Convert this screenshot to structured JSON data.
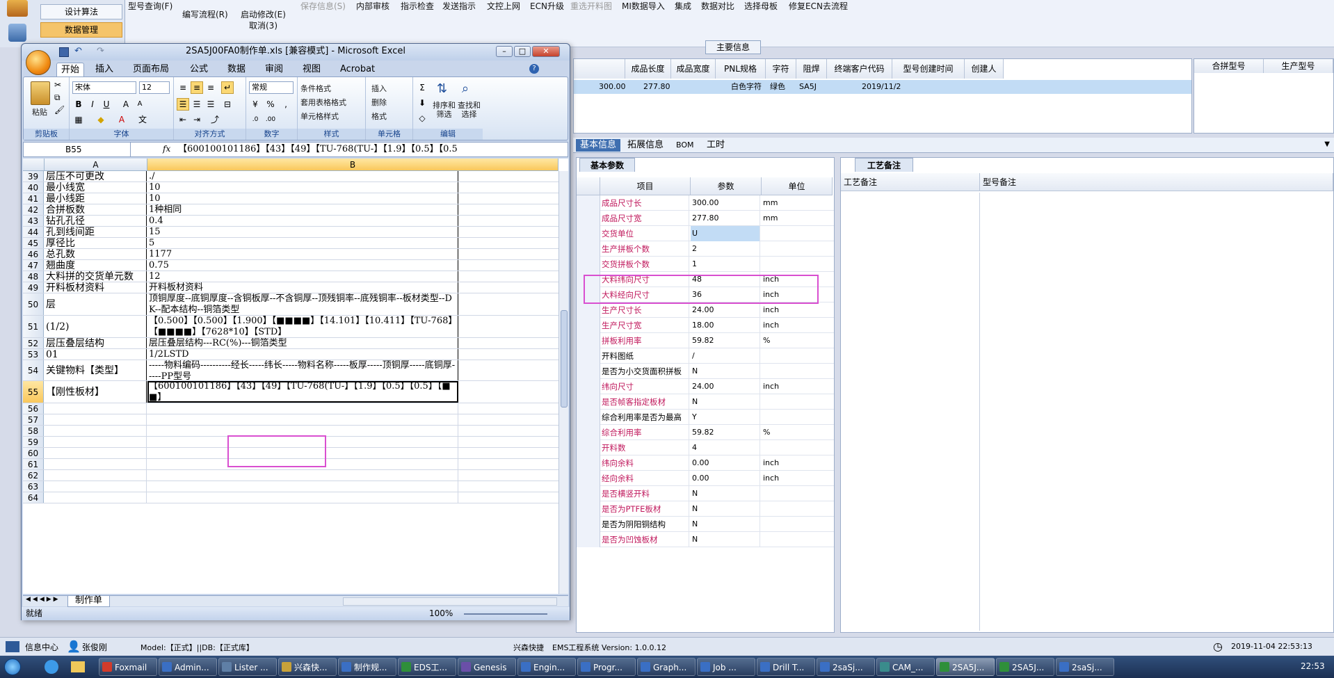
{
  "app": {
    "nav": [
      "设计算法",
      "数据管理"
    ],
    "menu": [
      "型号查询(F)",
      "编写流程(R)",
      "启动修改(E)",
      "保存信息(S)",
      "内部审核",
      "指示检查",
      "发送指示",
      "文控上网",
      "ECN升级",
      "重选开料图",
      "MI数据导入",
      "集成",
      "数据对比",
      "选择母板",
      "修复ECN去流程"
    ],
    "menu_sub": "取消(3)",
    "main_section": "主要信息",
    "top_grid": {
      "headers": [
        "成品长度",
        "成品宽度",
        "PNL规格",
        "字符",
        "阻焊",
        "终端客户代码",
        "型号创建时间",
        "创建人"
      ],
      "row": [
        "300.00",
        "277.80",
        "",
        "白色字符",
        "绿色",
        "SA5J",
        "2019/11/2",
        ""
      ]
    },
    "right_grid": {
      "headers": [
        "合拼型号",
        "生产型号"
      ]
    },
    "tabs": [
      "基本信息",
      "拓展信息",
      "BOM",
      "工时"
    ],
    "param_tab": "基本参数",
    "param_headers": [
      "项目",
      "参数",
      "单位"
    ],
    "params": [
      {
        "k": "成品尺寸长",
        "v": "300.00",
        "u": "mm",
        "red": true
      },
      {
        "k": "成品尺寸宽",
        "v": "277.80",
        "u": "mm",
        "red": true
      },
      {
        "k": "交货单位",
        "v": "U",
        "u": "",
        "red": true
      },
      {
        "k": "生产拼板个数",
        "v": "2",
        "u": "",
        "red": true
      },
      {
        "k": "交货拼板个数",
        "v": "1",
        "u": "",
        "red": true
      },
      {
        "k": "大料纬向尺寸",
        "v": "48",
        "u": "inch",
        "red": true
      },
      {
        "k": "大料经向尺寸",
        "v": "36",
        "u": "inch",
        "red": true
      },
      {
        "k": "生产尺寸长",
        "v": "24.00",
        "u": "inch",
        "red": true
      },
      {
        "k": "生产尺寸宽",
        "v": "18.00",
        "u": "inch",
        "red": true
      },
      {
        "k": "拼板利用率",
        "v": "59.82",
        "u": "%",
        "red": true
      },
      {
        "k": "开料图纸",
        "v": "/",
        "u": "",
        "red": false
      },
      {
        "k": "是否为小交货面积拼板",
        "v": "N",
        "u": "",
        "red": false
      },
      {
        "k": "纬向尺寸",
        "v": "24.00",
        "u": "inch",
        "red": true
      },
      {
        "k": "是否帧客指定板材",
        "v": "N",
        "u": "",
        "red": true
      },
      {
        "k": "综合利用率是否为最高",
        "v": "Y",
        "u": "",
        "red": false
      },
      {
        "k": "综合利用率",
        "v": "59.82",
        "u": "%",
        "red": true
      },
      {
        "k": "开料数",
        "v": "4",
        "u": "",
        "red": true
      },
      {
        "k": "纬向余料",
        "v": "0.00",
        "u": "inch",
        "red": true
      },
      {
        "k": "经向余料",
        "v": "0.00",
        "u": "inch",
        "red": true
      },
      {
        "k": "是否横竖开料",
        "v": "N",
        "u": "",
        "red": true
      },
      {
        "k": "是否为PTFE板材",
        "v": "N",
        "u": "",
        "red": true
      },
      {
        "k": "是否为阴阳铜结构",
        "v": "N",
        "u": "",
        "red": false
      },
      {
        "k": "是否为凹蚀板材",
        "v": "N",
        "u": "",
        "red": true
      }
    ],
    "remark_tab": "工艺备注",
    "remark_headers": [
      "工艺备注",
      "型号备注"
    ],
    "status": {
      "info": "信息中心",
      "user": "张俊刚",
      "model": "Model:【正式】||DB:【正式库】",
      "company": "兴森快捷",
      "system": "EMS工程系统 Version: 1.0.0.12",
      "datetime": "2019-11-04 22:53:13"
    }
  },
  "excel": {
    "title": "2SA5J00FA0制作单.xls [兼容模式] - Microsoft Excel",
    "tabs": [
      "开始",
      "插入",
      "页面布局",
      "公式",
      "数据",
      "审阅",
      "视图",
      "Acrobat"
    ],
    "font_name": "宋体",
    "font_size": "12",
    "number_format": "常规",
    "groups": [
      "剪贴板",
      "字体",
      "对齐方式",
      "数字",
      "样式",
      "单元格",
      "编辑"
    ],
    "ribbon_labels": {
      "paste": "粘贴",
      "cond": "条件格式",
      "table": "套用表格格式",
      "cell_style": "单元格样式",
      "insert": "插入",
      "delete": "删除",
      "format": "格式",
      "sort": "排序和\n筛选",
      "find": "查找和\n选择"
    },
    "name_box": "B55",
    "formula": "【600100101186】【43】【49】【TU-768(TU-】【1.9】【0.5】【0.5",
    "columns": [
      "A",
      "B"
    ],
    "rows": [
      {
        "n": "39",
        "a": "层压不可更改",
        "b": "./"
      },
      {
        "n": "40",
        "a": "最小线宽",
        "b": "10"
      },
      {
        "n": "41",
        "a": "最小线距",
        "b": "10"
      },
      {
        "n": "42",
        "a": "合拼板数",
        "b": "1种相同"
      },
      {
        "n": "43",
        "a": "钻孔孔径",
        "b": "0.4"
      },
      {
        "n": "44",
        "a": "孔到线间距",
        "b": "15"
      },
      {
        "n": "45",
        "a": "厚径比",
        "b": "5"
      },
      {
        "n": "46",
        "a": "总孔数",
        "b": "1177"
      },
      {
        "n": "47",
        "a": "翘曲度",
        "b": "0.75"
      },
      {
        "n": "48",
        "a": "大料拼的交货单元数",
        "b": "12"
      },
      {
        "n": "49",
        "a": "开料板材资料",
        "b": "开料板材资料"
      },
      {
        "n": "50",
        "a": "层",
        "b": "顶铜厚度--底铜厚度--含铜板厚--不含铜厚--顶残铜率--底残铜率--板材类型--DK--配本结构--铜箔类型"
      },
      {
        "n": "51",
        "a": "(1/2)",
        "b": "【0.500】【0.500】【1.900】【■■■■】【14.101】【10.411】【TU-768】【■■■■】【7628*10】【STD】"
      },
      {
        "n": "52",
        "a": "层压叠层结构",
        "b": "层压叠层结构---RC(%)---铜箔类型"
      },
      {
        "n": "53",
        "a": "01",
        "b": "1/2LSTD"
      },
      {
        "n": "54",
        "a": "关键物料【类型】",
        "b": "-----物料编码----------经长-----纬长-----物料名称-----板厚-----顶铜厚-----底铜厚-----PP型号"
      },
      {
        "n": "55",
        "a": "【刚性板材】",
        "b": "【600100101186】【43】【49】【TU-768(TU-】【1.9】【0.5】【0.5】【■■】"
      },
      {
        "n": "56",
        "a": "",
        "b": ""
      },
      {
        "n": "57",
        "a": "",
        "b": ""
      },
      {
        "n": "58",
        "a": "",
        "b": ""
      },
      {
        "n": "59",
        "a": "",
        "b": ""
      },
      {
        "n": "60",
        "a": "",
        "b": ""
      },
      {
        "n": "61",
        "a": "",
        "b": ""
      },
      {
        "n": "62",
        "a": "",
        "b": ""
      },
      {
        "n": "63",
        "a": "",
        "b": ""
      },
      {
        "n": "64",
        "a": "",
        "b": ""
      }
    ],
    "sheet_tab": "制作单",
    "status": "就绪",
    "zoom": "100%"
  },
  "taskbar": [
    "Foxmail",
    "Admin...",
    "Lister ...",
    "兴森快...",
    "制作规...",
    "EDS工...",
    "Genesis",
    "Engin...",
    "Progr...",
    "Graph...",
    "Job ...",
    "Drill T...",
    "2saSj...",
    "CAM_...",
    "2SA5J...",
    "2SA5J...",
    "2saSj..."
  ],
  "clock": "22:53"
}
